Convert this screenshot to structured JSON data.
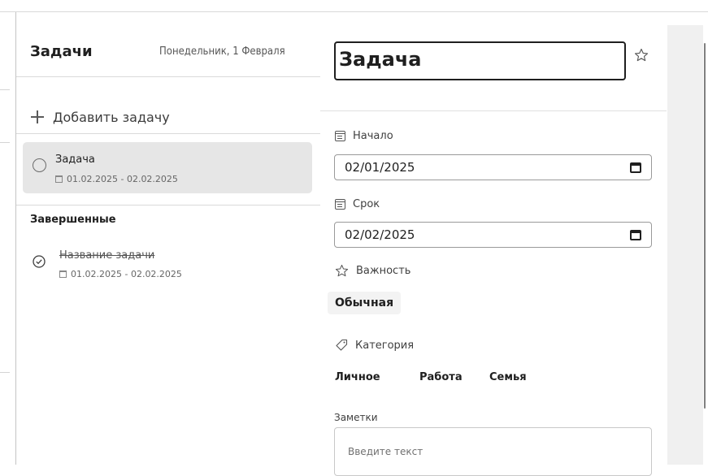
{
  "left": {
    "title": "Задачи",
    "date": "Понедельник, 1 Февраля",
    "add_task_label": "Добавить задачу",
    "active_tasks": [
      {
        "name": "Задача",
        "dates": "01.02.2025 - 02.02.2025",
        "selected": true
      }
    ],
    "completed_section_title": "Завершенные",
    "completed_tasks": [
      {
        "name": "Название задачи",
        "dates": "01.02.2025 - 02.02.2025"
      }
    ]
  },
  "detail": {
    "title_value": "Задача",
    "start_label": "Начало",
    "start_value": "02/01/2025",
    "due_label": "Срок",
    "due_value": "02/02/2025",
    "importance_label": "Важность",
    "importance_value": "Обычная",
    "category_label": "Категория",
    "categories": [
      "Личное",
      "Работа",
      "Семья"
    ],
    "notes_label": "Заметки",
    "notes_placeholder": "Введите текст"
  },
  "icons": {
    "add": "plus-icon",
    "task_status": "circle-icon",
    "completed_status": "check-circle-icon",
    "date": "calendar-icon",
    "favorite": "star-icon",
    "category": "tag-icon"
  },
  "colors": {
    "selected_bg": "#e6e6e6",
    "border_dark": "#1f1f1f",
    "side_strip": "#f0f0f0"
  }
}
